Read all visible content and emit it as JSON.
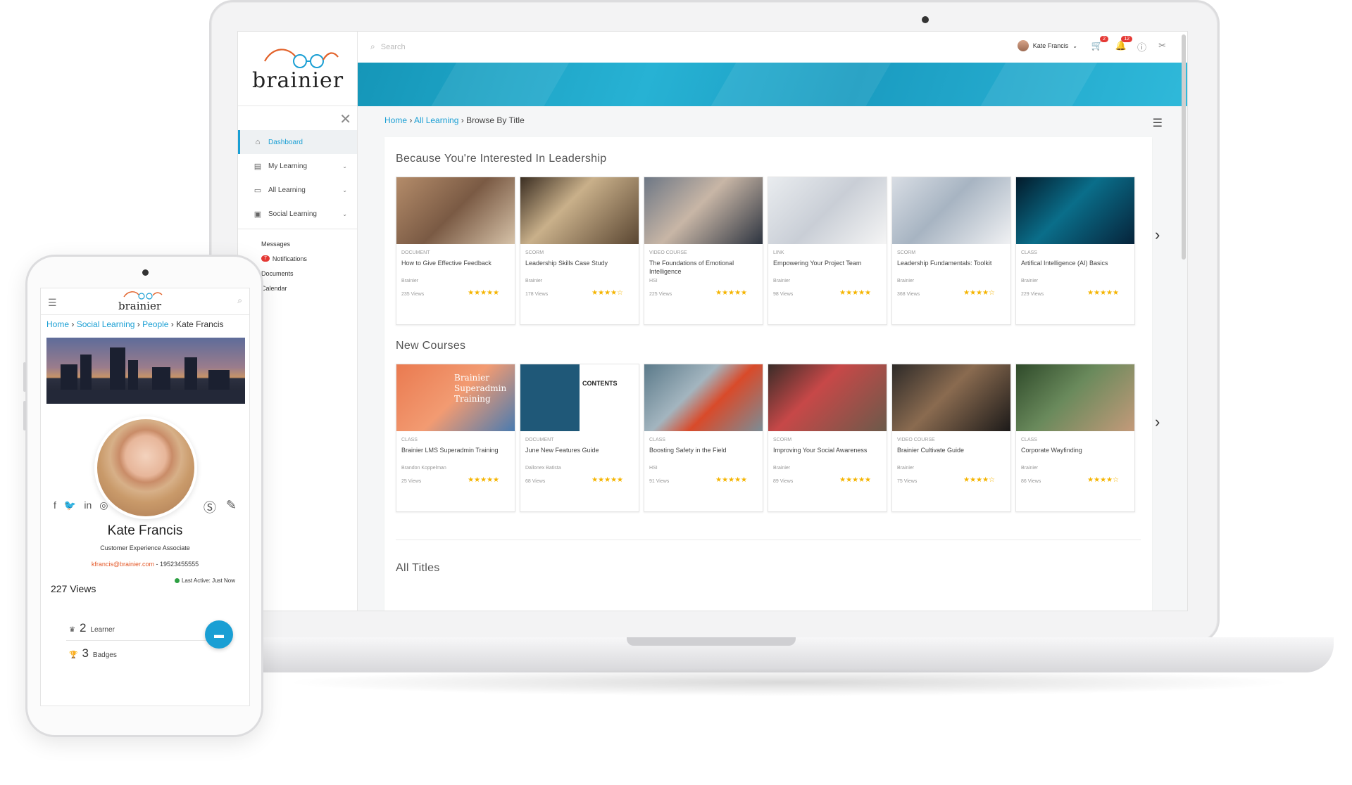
{
  "brand": {
    "logo_text": "brainier",
    "colors": {
      "accent": "#1a9fd4",
      "logo_orange": "#e2622a",
      "badge_red": "#e53935",
      "star": "#f5b400"
    }
  },
  "desktop": {
    "search_placeholder": "Search",
    "user_name": "Kate Francis",
    "cart_count": "2",
    "notif_count": "12",
    "sidebar": {
      "items": [
        {
          "label": "Dashboard",
          "icon": "home-icon"
        },
        {
          "label": "My Learning",
          "icon": "book-icon"
        },
        {
          "label": "All Learning",
          "icon": "folder-icon"
        },
        {
          "label": "Social Learning",
          "icon": "chat-icon"
        }
      ],
      "links": {
        "messages": "Messages",
        "notifications_count": "7",
        "notifications": "Notifications",
        "documents": "Documents",
        "calendar": "Calendar"
      }
    },
    "breadcrumb": {
      "home": "Home",
      "all_learning": "All Learning",
      "current": "Browse By Title"
    },
    "sections": [
      {
        "title": "Because You're Interested In Leadership",
        "cards": [
          {
            "type": "DOCUMENT",
            "title": "How to Give Effective Feedback",
            "author": "Brainier",
            "views": "235 Views",
            "rating": 5
          },
          {
            "type": "SCORM",
            "title": "Leadership Skills Case Study",
            "author": "Brainier",
            "views": "178 Views",
            "rating": 4
          },
          {
            "type": "VIDEO COURSE",
            "title": "The Foundations of Emotional Intelligence",
            "author": "HSI",
            "views": "225 Views",
            "rating": 5
          },
          {
            "type": "LINK",
            "title": "Empowering Your Project Team",
            "author": "Brainier",
            "views": "98 Views",
            "rating": 5
          },
          {
            "type": "SCORM",
            "title": "Leadership Fundamentals: Toolkit",
            "author": "Brainier",
            "views": "368 Views",
            "rating": 4
          },
          {
            "type": "CLASS",
            "title": "Artifical Intelligence (AI) Basics",
            "author": "Brainier",
            "views": "229 Views",
            "rating": 5
          }
        ]
      },
      {
        "title": "New Courses",
        "cards": [
          {
            "type": "CLASS",
            "title": "Brainier LMS Superadmin Training",
            "author": "Brandon Koppelman",
            "views": "25 Views",
            "rating": 5,
            "thumb_text": "Brainier Superadmin Training"
          },
          {
            "type": "DOCUMENT",
            "title": "June New Features Guide",
            "author": "Dallonex Batista",
            "views": "68 Views",
            "rating": 5,
            "thumb_text": "CONTENTS"
          },
          {
            "type": "CLASS",
            "title": "Boosting Safety in the Field",
            "author": "HSI",
            "views": "91 Views",
            "rating": 5
          },
          {
            "type": "SCORM",
            "title": "Improving Your Social Awareness",
            "author": "Brainier",
            "views": "89 Views",
            "rating": 5
          },
          {
            "type": "VIDEO COURSE",
            "title": "Brainier Cultivate Guide",
            "author": "Brainier",
            "views": "75 Views",
            "rating": 4
          },
          {
            "type": "CLASS",
            "title": "Corporate Wayfinding",
            "author": "Brainier",
            "views": "86 Views",
            "rating": 4
          }
        ]
      }
    ],
    "all_titles": "All Titles"
  },
  "mobile": {
    "breadcrumb": {
      "home": "Home",
      "social": "Social Learning",
      "people": "People",
      "current": "Kate Francis"
    },
    "profile": {
      "name": "Kate Francis",
      "role": "Customer Experience Associate",
      "email": "kfrancis@brainier.com",
      "phone": " - 19523455555",
      "last_active": "Last Active: Just Now",
      "views": "227 Views",
      "learner_count": "2",
      "learner_label": "Learner",
      "badges_count": "3",
      "badges_label": "Badges"
    }
  }
}
